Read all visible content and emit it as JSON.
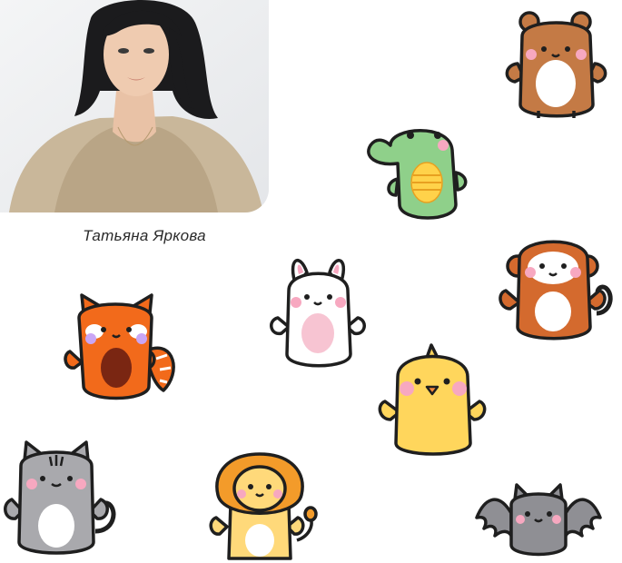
{
  "caption": "Татьяна Яркова",
  "stickers": [
    "bear",
    "crocodile",
    "monkey",
    "bunny",
    "red-panda",
    "chick",
    "cat",
    "lion",
    "bat"
  ],
  "colors": {
    "outline": "#1f1f1f",
    "bear": "#c47a45",
    "crocodile": "#8fd08a",
    "monkey": "#d46a2e",
    "bunny": "#ffffff",
    "red_panda": "#f26a1b",
    "chick": "#ffd65c",
    "cat": "#a9a9ad",
    "lion_mane": "#f39b2a",
    "lion_body": "#ffd97a",
    "bat": "#8f8f94",
    "blush": "#f7a8c0",
    "belly": "#ffffff"
  }
}
